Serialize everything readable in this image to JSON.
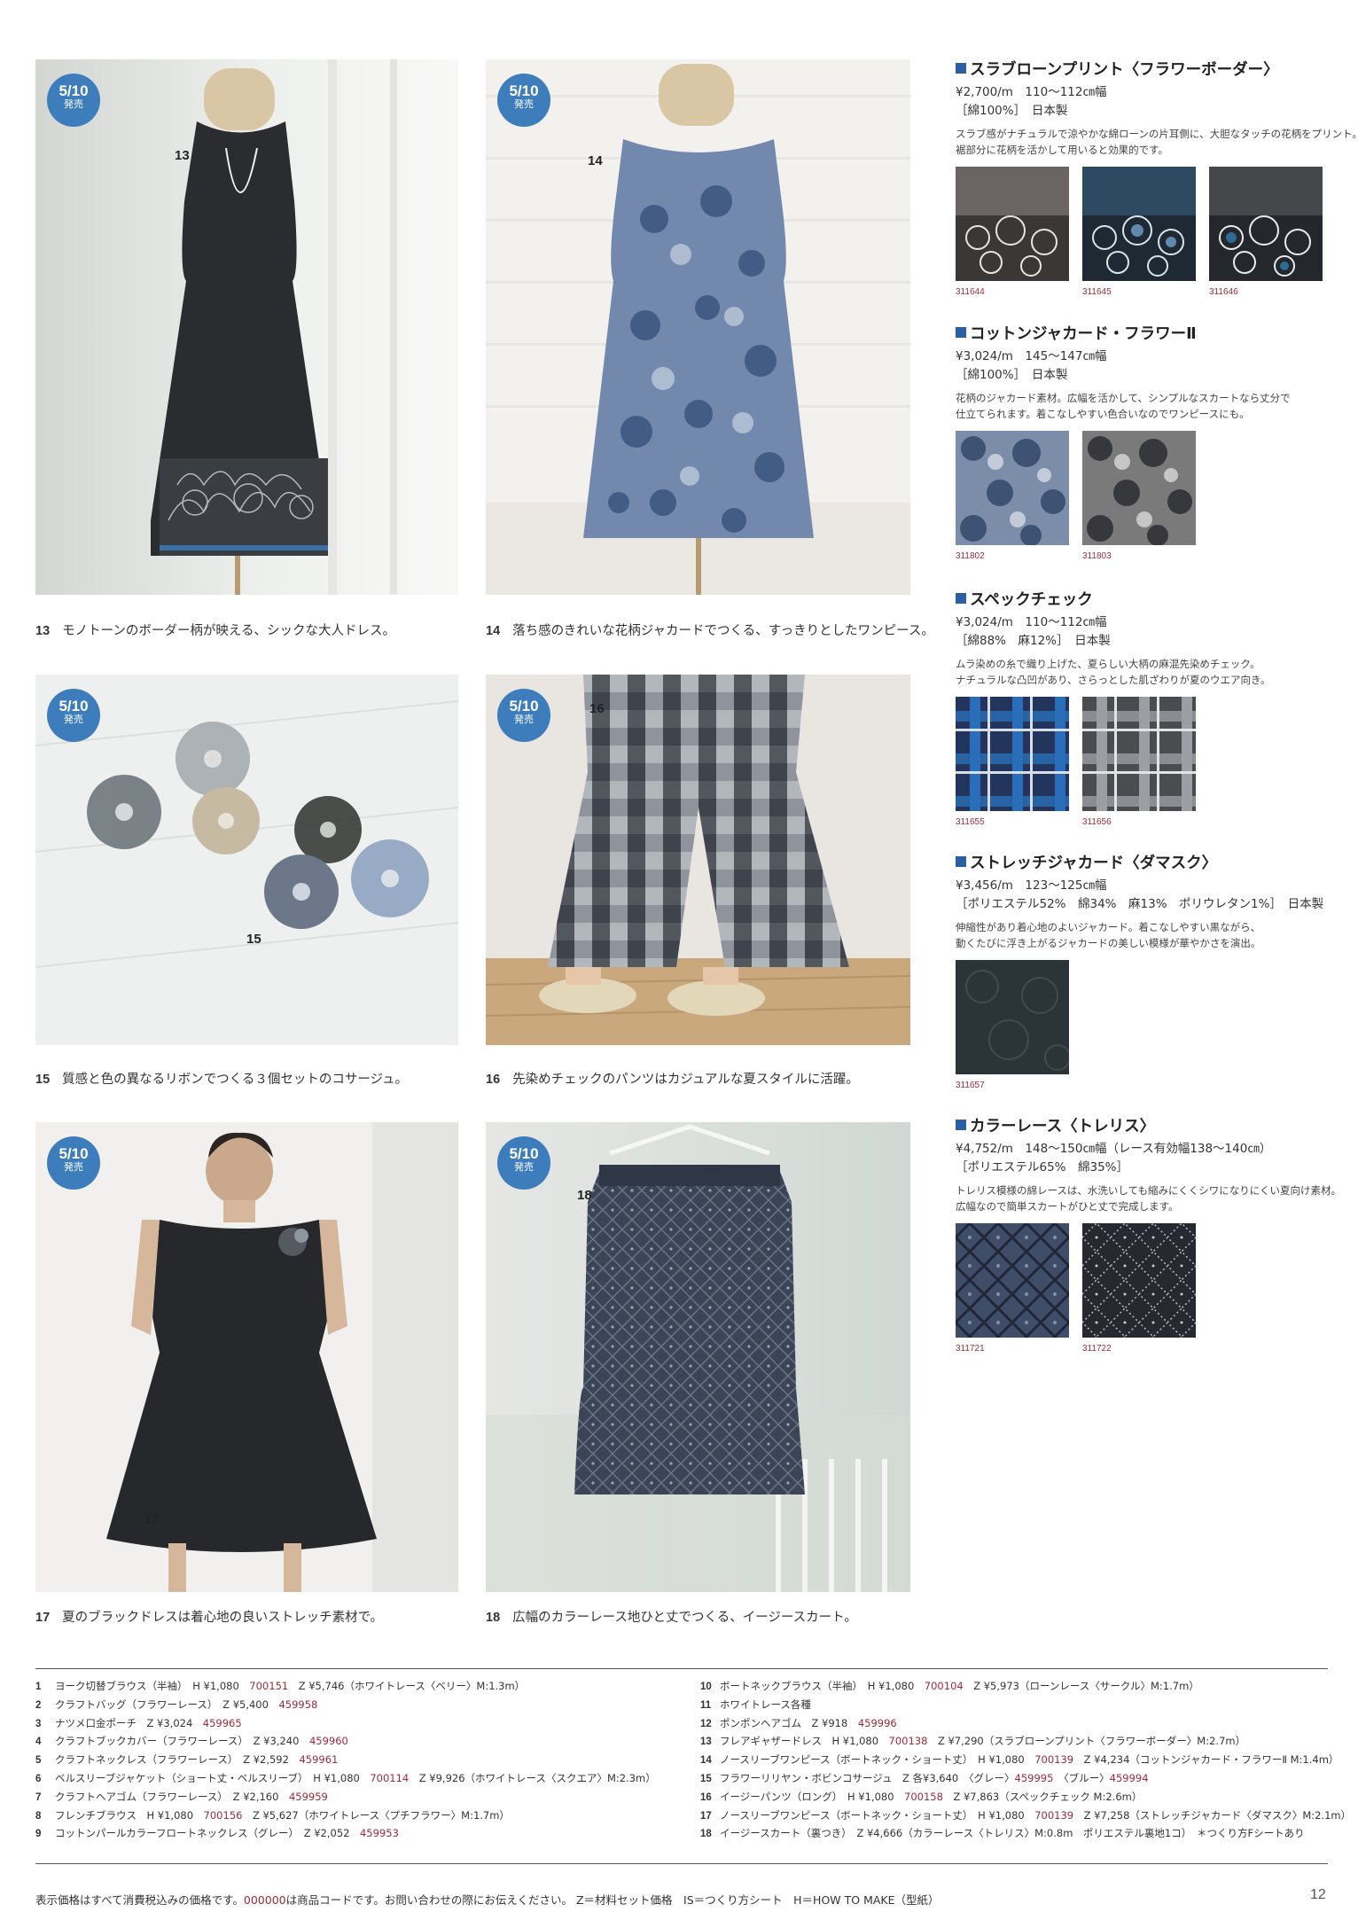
{
  "badge": {
    "date": "5/10",
    "sub": "発売"
  },
  "photos": [
    {
      "num": "13",
      "caption": "モノトーンのボーダー柄が映える、シックな大人ドレス。",
      "alt": "black dress photo"
    },
    {
      "num": "14",
      "caption": "落ち感のきれいな花柄ジャカードでつくる、すっきりとしたワンピース。",
      "alt": "floral jacquard dress photo"
    },
    {
      "num": "15",
      "caption": "質感と色の異なるリボンでつくる３個セットのコサージュ。",
      "alt": "ribbon corsage photo"
    },
    {
      "num": "16",
      "caption": "先染めチェックのパンツはカジュアルな夏スタイルに活躍。",
      "alt": "check pants photo"
    },
    {
      "num": "17",
      "caption": "夏のブラックドレスは着心地の良いストレッチ素材で。",
      "alt": "black stretch dress photo"
    },
    {
      "num": "18",
      "caption": "広幅のカラーレース地ひと丈でつくる、イージースカート。",
      "alt": "lace skirt photo"
    }
  ],
  "fabrics": [
    {
      "title": "スラブローンプリント〈フラワーボーダー〉",
      "price": "¥2,700/m　110〜112㎝幅",
      "spec": "［綿100%］　日本製",
      "desc1": "スラブ感がナチュラルで涼やかな綿ローンの片耳側に、大胆なタッチの花柄をプリント。",
      "desc2": "裾部分に花柄を活かして用いると効果的です。",
      "codes": [
        "311644",
        "311645",
        "311646"
      ]
    },
    {
      "title": "コットンジャカード・フラワーⅡ",
      "price": "¥3,024/m　145〜147㎝幅",
      "spec": "［綿100%］　日本製",
      "desc1": "花柄のジャカード素材。広幅を活かして、シンプルなスカートなら丈分で",
      "desc2": "仕立てられます。着こなしやすい色合いなのでワンピースにも。",
      "codes": [
        "311802",
        "311803"
      ]
    },
    {
      "title": "スペックチェック",
      "price": "¥3,024/m　110〜112㎝幅",
      "spec": "［綿88%　麻12%］　日本製",
      "desc1": "ムラ染めの糸で織り上げた、夏らしい大柄の麻混先染めチェック。",
      "desc2": "ナチュラルな凸凹があり、さらっとした肌ざわりが夏のウエア向き。",
      "codes": [
        "311655",
        "311656"
      ]
    },
    {
      "title": "ストレッチジャカード〈ダマスク〉",
      "price": "¥3,456/m　123〜125㎝幅",
      "spec": "［ポリエステル52%　綿34%　麻13%　ポリウレタン1%］　日本製",
      "desc1": "伸縮性があり着心地のよいジャカード。着こなしやすい黒ながら、",
      "desc2": "動くたびに浮き上がるジャカードの美しい模様が華やかさを演出。",
      "codes": [
        "311657"
      ]
    },
    {
      "title": "カラーレース〈トレリス〉",
      "price": "¥4,752/m　148〜150㎝幅（レース有効幅138〜140㎝）",
      "spec": "［ポリエステル65%　綿35%］",
      "desc1": "トレリス模様の綿レースは、水洗いしても縮みにくくシワになりにくい夏向け素材。",
      "desc2": "広幅なので簡単スカートがひと丈で完成します。",
      "codes": [
        "311721",
        "311722"
      ]
    }
  ],
  "products_left": [
    {
      "no": "1",
      "pre": "ヨーク切替ブラウス（半袖）　H ¥1,080　",
      "code": "700151",
      "post": "　Z ¥5,746（ホワイトレース〈ベリー〉M:1.3m）"
    },
    {
      "no": "2",
      "pre": "クラフトバッグ（フラワーレース）　Z ¥5,400　",
      "code": "459958",
      "post": ""
    },
    {
      "no": "3",
      "pre": "ナツメ口金ポーチ　Z ¥3,024　",
      "code": "459965",
      "post": ""
    },
    {
      "no": "4",
      "pre": "クラフトブックカバー（フラワーレース）　Z ¥3,240　",
      "code": "459960",
      "post": ""
    },
    {
      "no": "5",
      "pre": "クラフトネックレス（フラワーレース）　Z ¥2,592　",
      "code": "459961",
      "post": ""
    },
    {
      "no": "6",
      "pre": "ベルスリーブジャケット（ショート丈・ベルスリーブ）　H ¥1,080　",
      "code": "700114",
      "post": "　Z ¥9,926（ホワイトレース〈スクエア〉M:2.3m）"
    },
    {
      "no": "7",
      "pre": "クラフトヘアゴム（フラワーレース）　Z ¥2,160　",
      "code": "459959",
      "post": ""
    },
    {
      "no": "8",
      "pre": "フレンチブラウス　H ¥1,080　",
      "code": "700156",
      "post": "　Z ¥5,627（ホワイトレース〈プチフラワー〉M:1.7m）"
    },
    {
      "no": "9",
      "pre": "コットンパールカラーフロートネックレス（グレー）　Z ¥2,052　",
      "code": "459953",
      "post": ""
    }
  ],
  "products_right": [
    {
      "no": "10",
      "pre": "ボートネックブラウス（半袖）　H ¥1,080　",
      "code": "700104",
      "post": "　Z ¥5,973（ローンレース〈サークル〉M:1.7m）"
    },
    {
      "no": "11",
      "pre": "ホワイトレース各種",
      "code": "",
      "post": ""
    },
    {
      "no": "12",
      "pre": "ポンポンヘアゴム　Z ¥918　",
      "code": "459996",
      "post": ""
    },
    {
      "no": "13",
      "pre": "フレアギャザードレス　H ¥1,080　",
      "code": "700138",
      "post": "　Z ¥7,290（スラブローンプリント〈フラワーボーダー〉M:2.7m）"
    },
    {
      "no": "14",
      "pre": "ノースリーブワンピース（ボートネック・ショート丈）　H ¥1,080　",
      "code": "700139",
      "post": "　Z ¥4,234（コットンジャカード・フラワーⅡ M:1.4m）"
    },
    {
      "no": "15",
      "pre": "フラワーリリヤン・ボビンコサージュ　Z 各¥3,640　〈グレー〉",
      "code": "459995",
      "post": "　〈ブルー〉",
      "code2": "459994"
    },
    {
      "no": "16",
      "pre": "イージーパンツ（ロング）　H ¥1,080　",
      "code": "700158",
      "post": "　Z ¥7,863（スペックチェック M:2.6m）"
    },
    {
      "no": "17",
      "pre": "ノースリーブワンピース（ボートネック・ショート丈）　H ¥1,080　",
      "code": "700139",
      "post": "　Z ¥7,258（ストレッチジャカード〈ダマスク〉M:2.1m）"
    },
    {
      "no": "18",
      "pre": "イージースカート（裏つき）　Z ¥4,666（カラーレース〈トレリス〉M:0.8m　ポリエステル裏地1コ）　＊つくり方Fシートあり",
      "code": "",
      "post": ""
    }
  ],
  "footer": {
    "a": "表示価格はすべて消費税込みの価格です。",
    "code": "000000",
    "b": "は商品コードです。お問い合わせの際にお伝えください。 Z＝材料セット価格　IS＝つくり方シート　H＝HOW TO MAKE（型紙）",
    "page": "12"
  }
}
